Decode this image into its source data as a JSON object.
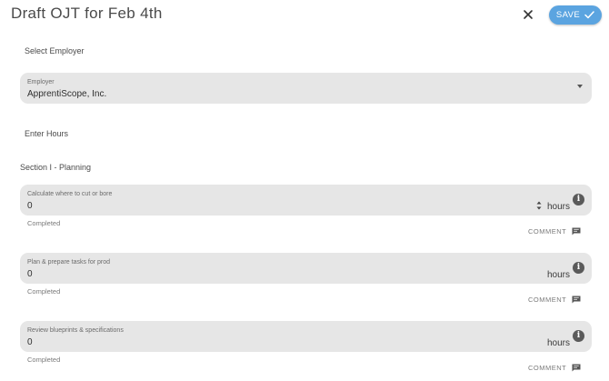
{
  "header": {
    "title": "Draft OJT for Feb 4th",
    "save_label": "SAVE"
  },
  "employer_section": {
    "heading": "Select Employer",
    "field_label": "Employer",
    "field_value": "ApprentiScope, Inc."
  },
  "hours_heading": "Enter Hours",
  "section_title": "Section I - Planning",
  "tasks": [
    {
      "label": "Calculate where to cut or bore",
      "value": "0",
      "unit": "hours",
      "status": "Completed",
      "comment_label": "COMMENT"
    },
    {
      "label": "Plan & prepare tasks for prod",
      "value": "0",
      "unit": "hours",
      "status": "Completed",
      "comment_label": "COMMENT"
    },
    {
      "label": "Review blueprints & specifications",
      "value": "0",
      "unit": "hours",
      "status": "Completed",
      "comment_label": "COMMENT"
    }
  ],
  "icons": {
    "close": "close-icon",
    "save": "check-icon",
    "info": "info-icon",
    "comment": "comment-icon",
    "dropdown": "dropdown-arrow-icon"
  },
  "colors": {
    "accent": "#5ba4e0",
    "field_bg": "#e6e6e6"
  }
}
